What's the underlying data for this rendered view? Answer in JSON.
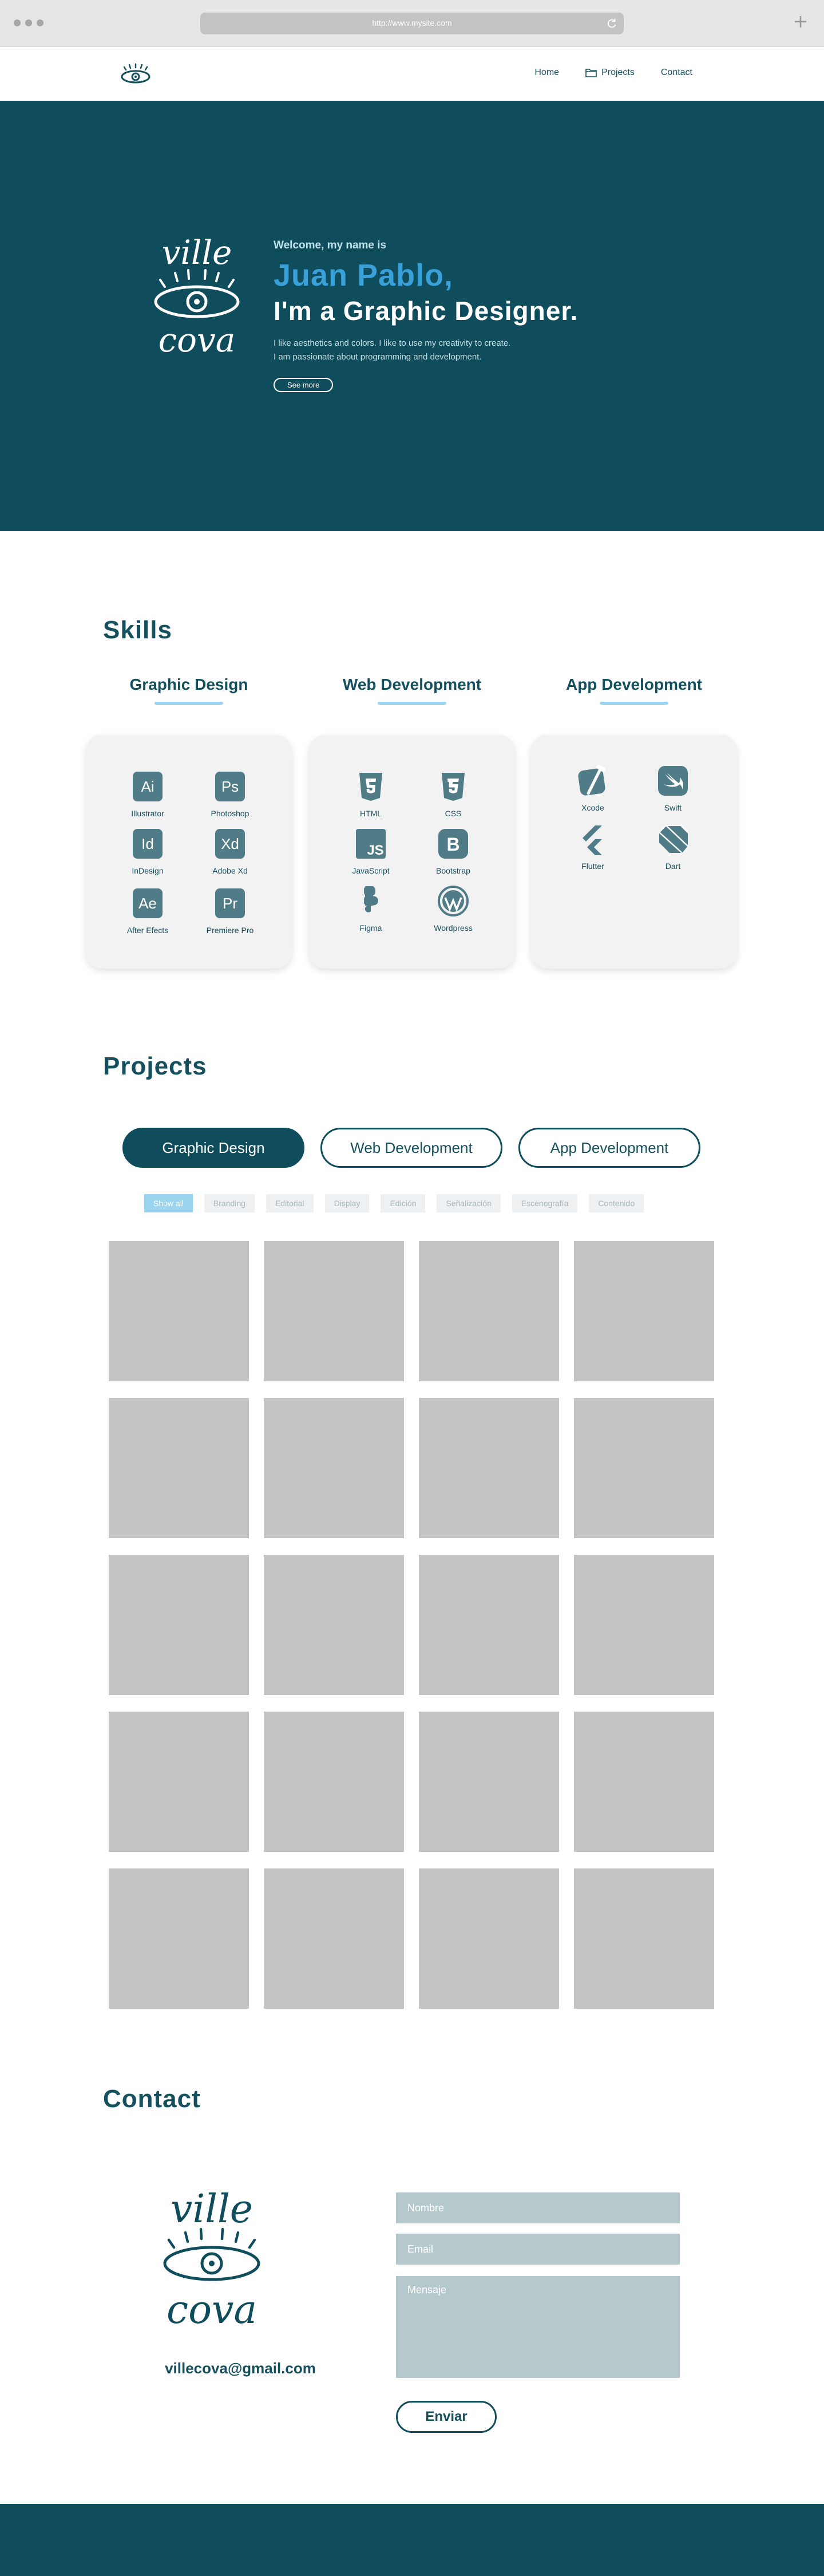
{
  "browser": {
    "url": "http://www.mysite.com"
  },
  "nav": {
    "items": [
      {
        "label": "Home"
      },
      {
        "label": "Projects"
      },
      {
        "label": "Contact"
      }
    ]
  },
  "hero": {
    "welcome": "Welcome, my name is",
    "name": "Juan Pablo,",
    "role": "I'm a Graphic Designer.",
    "desc_line1": "I like aesthetics and colors. I like to use my creativity to create.",
    "desc_line2": "I am passionate about programming and development.",
    "button": "See more",
    "logo_text_top": "ville",
    "logo_text_bottom": "cova"
  },
  "skills": {
    "title": "Skills",
    "columns": [
      {
        "title": "Graphic Design",
        "items": [
          {
            "icon": "Ai",
            "label": "Illustrator"
          },
          {
            "icon": "Ps",
            "label": "Photoshop"
          },
          {
            "icon": "Id",
            "label": "InDesign"
          },
          {
            "icon": "Xd",
            "label": "Adobe Xd"
          },
          {
            "icon": "Ae",
            "label": "After Efects"
          },
          {
            "icon": "Pr",
            "label": "Premiere Pro"
          }
        ]
      },
      {
        "title": "Web Development",
        "items": [
          {
            "icon": "html5-icon",
            "label": "HTML"
          },
          {
            "icon": "css3-icon",
            "label": "CSS"
          },
          {
            "icon": "JS",
            "label": "JavaScript"
          },
          {
            "icon": "B",
            "label": "Bootstrap"
          },
          {
            "icon": "figma-icon",
            "label": "Figma"
          },
          {
            "icon": "wordpress-icon",
            "label": "Wordpress"
          }
        ]
      },
      {
        "title": "App Development",
        "items": [
          {
            "icon": "xcode-icon",
            "label": "Xcode"
          },
          {
            "icon": "swift-icon",
            "label": "Swift"
          },
          {
            "icon": "flutter-icon",
            "label": "Flutter"
          },
          {
            "icon": "dart-icon",
            "label": "Dart"
          }
        ]
      }
    ]
  },
  "projects": {
    "title": "Projects",
    "categories": [
      {
        "label": "Graphic Design",
        "active": true
      },
      {
        "label": "Web Development",
        "active": false
      },
      {
        "label": "App Development",
        "active": false
      }
    ],
    "filters": [
      {
        "label": "Show all",
        "active": true
      },
      {
        "label": "Branding"
      },
      {
        "label": "Editorial"
      },
      {
        "label": "Display"
      },
      {
        "label": "Edición"
      },
      {
        "label": "Señalización"
      },
      {
        "label": "Escenografía"
      },
      {
        "label": "Contenido"
      }
    ],
    "tile_count": 20
  },
  "contact": {
    "title": "Contact",
    "email": "villecova@gmail.com",
    "name_placeholder": "Nombre",
    "email_placeholder": "Email",
    "message_placeholder": "Mensaje",
    "send": "Enviar"
  },
  "colors": {
    "primary": "#0f4c5c",
    "accent": "#3aa0d8",
    "light_accent": "#9ad4ef",
    "tile": "#c4c4c4"
  }
}
